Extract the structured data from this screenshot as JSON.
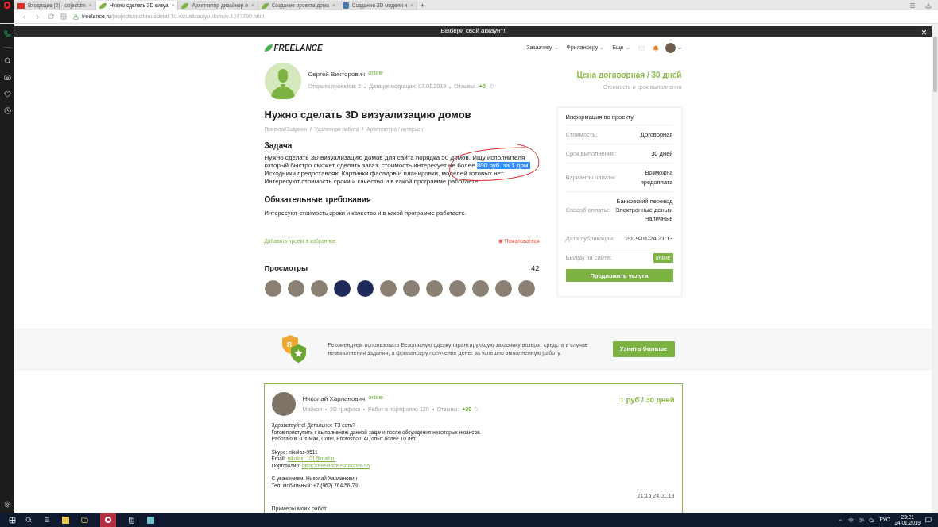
{
  "browser": {
    "tabs": [
      {
        "label": "Входящие (2) - objectdm",
        "selected": false,
        "kind": "mail"
      },
      {
        "label": "Нужно сделать 3D визуа",
        "selected": true,
        "kind": "site"
      },
      {
        "label": "Архитектор-дизайнер и",
        "selected": false,
        "kind": "site"
      },
      {
        "label": "Создание проекта дома",
        "selected": false,
        "kind": "site"
      },
      {
        "label": "Создание 3D-модели и",
        "selected": false,
        "kind": "vk"
      }
    ],
    "tab_close": "×",
    "tab_add": "+",
    "url_host": "freelance.ru",
    "url_path": "/projects/nuzhno-sdelat-3d-vizualizaciyu-domov-1047790.html"
  },
  "banner": {
    "text": "Выбери свой аккаунт!",
    "close": "×"
  },
  "header": {
    "logo": "FREELANCE",
    "nav": [
      "Заказчику",
      "Фрилансеру",
      "Еще"
    ]
  },
  "client": {
    "name": "Сергей Викторович",
    "status": "online",
    "stats": [
      "Открыто проектов: 2",
      "Дата регистрации: 07.01.2019"
    ],
    "reviews_label": "Отзывы:",
    "reviews_plus": "+0",
    "reviews_minus": "-0",
    "price": "Цена договорная / 30 дней",
    "price_caption": "Стоимость и срок выполнения"
  },
  "project": {
    "title": "Нужно сделать 3D визуализацию домов",
    "breadcrumbs": [
      "Проекты/Задания",
      "Удаленная работа",
      "Архитектура / интерьер"
    ],
    "breadcrumb_separator": "/",
    "task_heading": "Задача",
    "task_text": [
      {
        "text": "Нужно сделать 3D визуализацию домов для сайта порядка 50 домов. Ищу исполнителя\nкоторый быстро сможет сделать заказ. стоимость интересует не более ",
        "selected": false
      },
      {
        "text": "800 руб. за 1 дом.",
        "selected": true
      },
      {
        "text": "\nИсходники предоставляю Картинки фасадов и планировки, моделей готовых нет.\nИнтересуют стоимость сроки и качество и в какой программе работаете.",
        "selected": false
      }
    ],
    "requirements_heading": "Обязательные требования",
    "requirements_text": "Интересуют стоимость сроки и качество и в какой программе работаете.",
    "favorite_link": "Добавить проект в избранное",
    "complain_link": "Пожаловаться",
    "views_heading": "Просмотры",
    "views_count": "42",
    "viewers": [
      {
        "kind": "photo"
      },
      {
        "kind": "photo"
      },
      {
        "kind": "photo"
      },
      {
        "kind": "logo"
      },
      {
        "kind": "logo"
      },
      {
        "kind": "photo"
      },
      {
        "kind": "photo"
      },
      {
        "kind": "photo"
      },
      {
        "kind": "photo"
      },
      {
        "kind": "photo"
      },
      {
        "kind": "photo"
      },
      {
        "kind": "photo"
      }
    ]
  },
  "info": {
    "title": "Информация по проекту",
    "rows": [
      {
        "label": "Стоимость:",
        "kind": "text",
        "lines": [
          "Договорная"
        ]
      },
      {
        "label": "Срок выполнения:",
        "kind": "text",
        "lines": [
          "30 дней"
        ]
      },
      {
        "label": "Варианты оплаты:",
        "kind": "text",
        "lines": [
          "Возможна предоплата"
        ]
      },
      {
        "label": "Способ оплаты:",
        "kind": "text",
        "lines": [
          "Банковский перевод",
          "Электронные деньги",
          "Наличные"
        ]
      },
      {
        "label": "Дата публикации:",
        "kind": "text",
        "lines": [
          "2019-01-24 21:13"
        ]
      },
      {
        "label": "Был(а) на сайте:",
        "kind": "badge",
        "lines": [
          "online"
        ]
      }
    ],
    "button": "Предложить услуги"
  },
  "safe_deal": {
    "shield_letter": "Я",
    "text": "Рекомендуем использовать Безопасную сделку гарантирующую заказчику возврат средств в случае невыполнения задания, а фрилансеру получение денег за успешно выполненную работу.",
    "button": "Узнать больше"
  },
  "response": {
    "name": "Николай Харланович",
    "status": "online",
    "stats": [
      "Майкоп",
      "3D графика",
      "Работ в портфолио  120"
    ],
    "reviews_label": "Отзывы:",
    "reviews_plus": "+30",
    "reviews_minus": "0",
    "price": "1 руб / 30 дней",
    "paragraphs": [
      [
        {
          "text": "Здравствуйте! Детальнее ТЗ есть?"
        },
        {
          "text": "Готов приступить к выполнению данной задачи после обсуждения некоторых нюансов."
        },
        {
          "text": "Работаю в 3Ds Max, Corel, Photoshop, Ai, опыт более 10 лет."
        }
      ],
      [
        {
          "text": "Skype: nikolas-9511"
        },
        {
          "text": "Email:",
          "link": "nikolas_101@mail.ru"
        },
        {
          "text": "Портфолио:",
          "link": "https://freelance.ru/nikolas-95"
        }
      ],
      [
        {
          "text": "С уважением, Николай Харланович"
        },
        {
          "text": "Тел. мобильный: +7 (962) 764-56-79"
        }
      ]
    ],
    "timestamp": "21:15 24.01.19",
    "next_heading": "Примеры моих работ"
  },
  "taskbar": {
    "language": "РУС",
    "time": "23:21",
    "date": "24.01.2019"
  }
}
